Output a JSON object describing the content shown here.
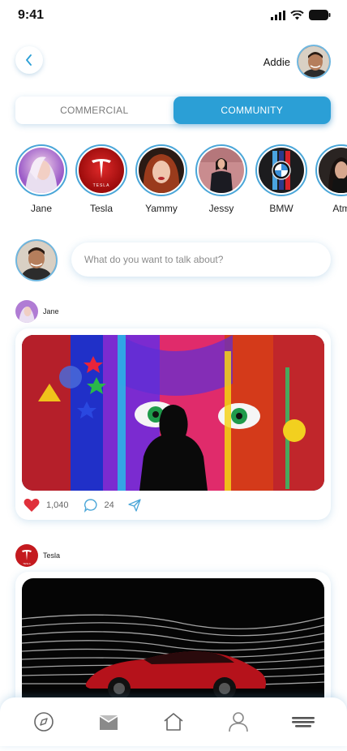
{
  "status": {
    "time": "9:41"
  },
  "header": {
    "user_name": "Addie"
  },
  "segments": [
    {
      "label": "COMMERCIAL",
      "active": false
    },
    {
      "label": "COMMUNITY",
      "active": true
    }
  ],
  "stories": [
    {
      "label": "Jane"
    },
    {
      "label": "Tesla"
    },
    {
      "label": "Yammy"
    },
    {
      "label": "Jessy"
    },
    {
      "label": "BMW"
    },
    {
      "label": "Atm"
    }
  ],
  "composer": {
    "placeholder": "What do you want to talk about?"
  },
  "posts": [
    {
      "author": "Jane",
      "likes": "1,040",
      "comments": "24"
    },
    {
      "author": "Tesla"
    }
  ],
  "brand": {
    "tesla_logo_text": "TESLA"
  },
  "colors": {
    "accent": "#2b9fd6",
    "like": "#e0303b"
  },
  "nav": [
    {
      "icon": "compass-icon"
    },
    {
      "icon": "mail-icon"
    },
    {
      "icon": "home-icon"
    },
    {
      "icon": "profile-icon"
    },
    {
      "icon": "menu-icon"
    }
  ]
}
